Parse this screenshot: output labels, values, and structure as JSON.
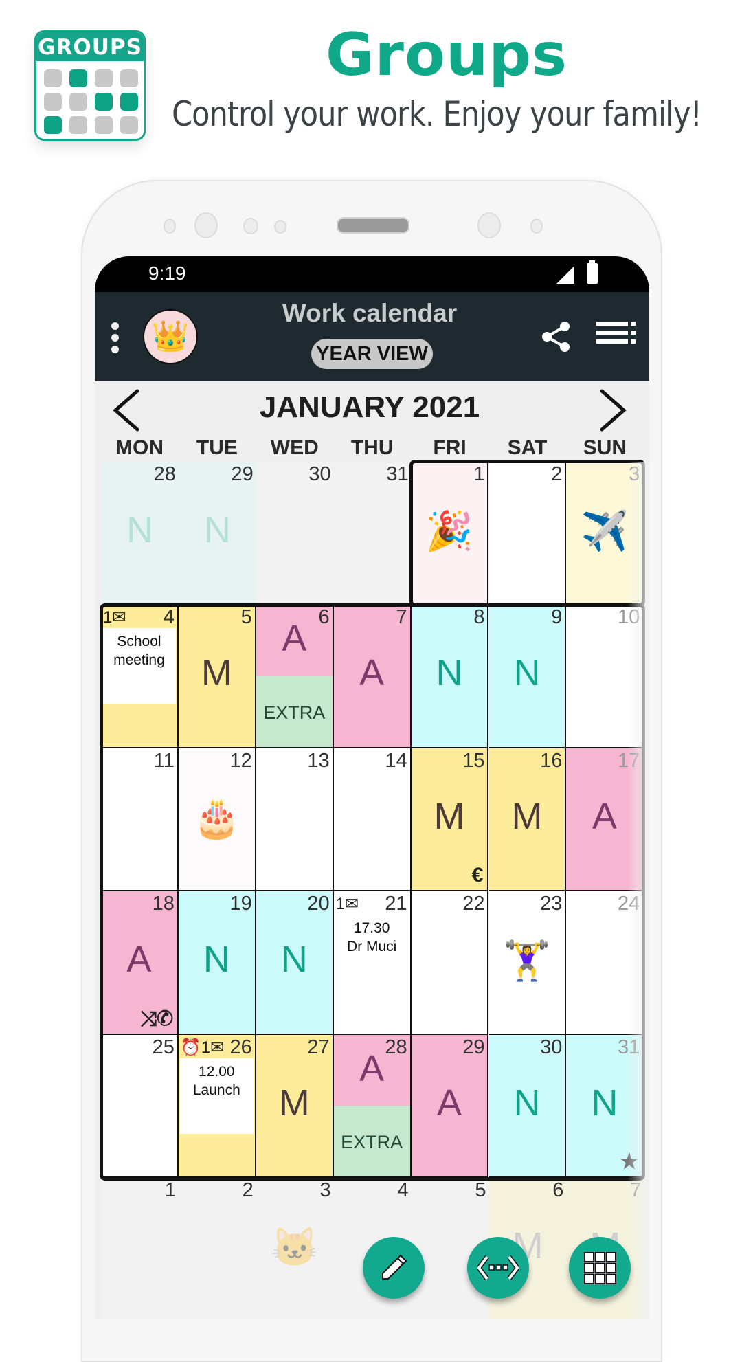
{
  "promo": {
    "logo_label": "GROUPS",
    "logo_cells": [
      0,
      1,
      0,
      0,
      0,
      0,
      1,
      1,
      1,
      0,
      0,
      0
    ],
    "title": "Groups",
    "subtitle": "Control your work. Enjoy your family!"
  },
  "status_bar": {
    "time": "9:19",
    "signal_icon": "signal-icon",
    "battery_icon": "battery-icon"
  },
  "app_bar": {
    "title": "Work calendar",
    "view_button": "YEAR VIEW",
    "avatar_icon": "👑",
    "icons": [
      "overflow-menu-icon",
      "crown-avatar-icon",
      "share-icon",
      "list-menu-icon"
    ]
  },
  "calendar": {
    "month_label": "JANUARY 2021",
    "weekdays": [
      "MON",
      "TUE",
      "WED",
      "THU",
      "FRI",
      "SAT",
      "SUN"
    ],
    "colors": {
      "M": "#fdec9a",
      "A": "#f6b6d2",
      "N": "#ccfafa",
      "EXTRA": "#c6e8cf",
      "M_text": "#4c3a3a",
      "A_text": "#7b3b6a",
      "N_text": "#10a38a",
      "EXTRA_text": "#1f4a38"
    },
    "rows": [
      [
        {
          "day": "28",
          "other": true,
          "shift": "N",
          "bg": "#e6f3f2"
        },
        {
          "day": "29",
          "other": true,
          "shift": "N",
          "bg": "#e6f3f2"
        },
        {
          "day": "30",
          "other": true,
          "bg": "#f2f2f2"
        },
        {
          "day": "31",
          "other": true,
          "bg": "#f2f2f2"
        },
        {
          "day": "1",
          "bg": "#fdf2f3",
          "emoji": "🎉"
        },
        {
          "day": "2",
          "bg": "#ffffff"
        },
        {
          "day": "3",
          "bg": "#fdf9d8",
          "emoji": "✈️",
          "faded_num": true
        }
      ],
      [
        {
          "day": "4",
          "bg": "#fdec9a",
          "badge": "1✉",
          "note": "School\nmeeting"
        },
        {
          "day": "5",
          "shift": "M"
        },
        {
          "day": "6",
          "shift": "A",
          "split": "EXTRA"
        },
        {
          "day": "7",
          "shift": "A"
        },
        {
          "day": "8",
          "shift": "N"
        },
        {
          "day": "9",
          "shift": "N"
        },
        {
          "day": "10",
          "bg": "#ffffff",
          "faded_num": true
        }
      ],
      [
        {
          "day": "11",
          "bg": "#ffffff"
        },
        {
          "day": "12",
          "bg": "#fdfafb",
          "emoji": "🎂"
        },
        {
          "day": "13",
          "bg": "#ffffff"
        },
        {
          "day": "14",
          "bg": "#ffffff"
        },
        {
          "day": "15",
          "shift": "M",
          "corner": "€"
        },
        {
          "day": "16",
          "shift": "M"
        },
        {
          "day": "17",
          "shift": "A",
          "faded_num": true
        }
      ],
      [
        {
          "day": "18",
          "shift": "A",
          "corner": "⤨✆"
        },
        {
          "day": "19",
          "shift": "N"
        },
        {
          "day": "20",
          "shift": "N"
        },
        {
          "day": "21",
          "bg": "#ffffff",
          "badge": "1✉",
          "plain_note": "17.30\nDr Muci"
        },
        {
          "day": "22",
          "bg": "#ffffff"
        },
        {
          "day": "23",
          "bg": "#ffffff",
          "emoji": "🏋️‍♀️"
        },
        {
          "day": "24",
          "bg": "#ffffff",
          "faded_num": true
        }
      ],
      [
        {
          "day": "25",
          "bg": "#ffffff"
        },
        {
          "day": "26",
          "bg": "#fdec9a",
          "badge": "⏰1✉",
          "note": "12.00\nLaunch"
        },
        {
          "day": "27",
          "shift": "M"
        },
        {
          "day": "28",
          "shift": "A",
          "split": "EXTRA"
        },
        {
          "day": "29",
          "shift": "A"
        },
        {
          "day": "30",
          "shift": "N"
        },
        {
          "day": "31",
          "shift": "N",
          "corner": "★",
          "faded_num": true
        }
      ],
      [
        {
          "day": "1",
          "other": true,
          "bg": "#f2f2f2"
        },
        {
          "day": "2",
          "other": true,
          "bg": "#f2f2f2"
        },
        {
          "day": "3",
          "other": true,
          "bg": "#f2f2f2",
          "emoji": "🐱"
        },
        {
          "day": "4",
          "other": true,
          "bg": "#f2f2f2"
        },
        {
          "day": "5",
          "other": true,
          "bg": "#f2f2f2"
        },
        {
          "day": "6",
          "other": true,
          "bg": "#f4f2dc",
          "shift": "M"
        },
        {
          "day": "7",
          "other": true,
          "bg": "#f4f2dc",
          "shift": "M",
          "faded_num": true
        }
      ]
    ]
  },
  "fabs": [
    {
      "name": "edit-fab",
      "icon": "pencil-icon"
    },
    {
      "name": "range-fab",
      "icon": "code-range-icon"
    },
    {
      "name": "grid-view-fab",
      "icon": "grid-icon"
    }
  ]
}
